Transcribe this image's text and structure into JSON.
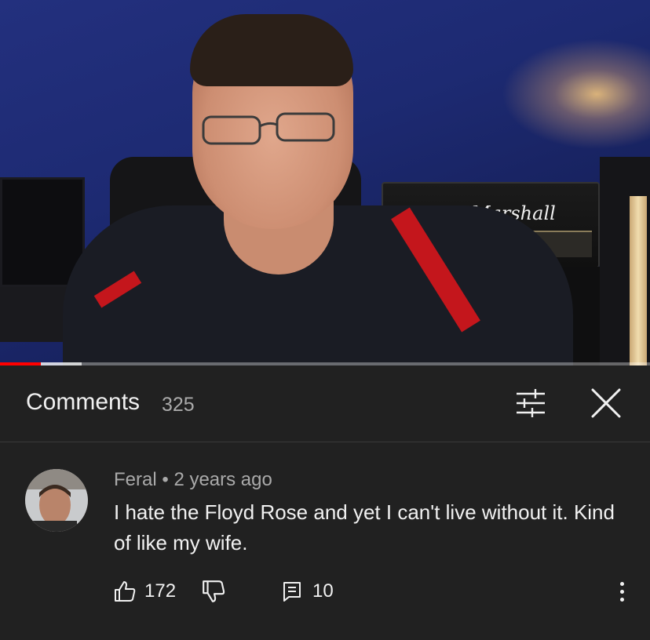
{
  "video": {
    "amp_brand": "Marshall",
    "progress_played": 0.063,
    "progress_buffered": 0.126,
    "colors": {
      "played": "#ff0000",
      "background": "#1d2a72"
    }
  },
  "comments_header": {
    "title": "Comments",
    "count": "325",
    "filter_icon": "sliders-icon",
    "close_icon": "close-icon"
  },
  "comment": {
    "author": "Feral",
    "separator": "•",
    "time": "2 years ago",
    "text": "I hate the Floyd Rose and yet I can't live without it. Kind of like my wife.",
    "likes": "172",
    "replies": "10",
    "icons": {
      "like": "thumbs-up-icon",
      "dislike": "thumbs-down-icon",
      "reply": "reply-icon",
      "more": "more-vertical-icon"
    }
  }
}
